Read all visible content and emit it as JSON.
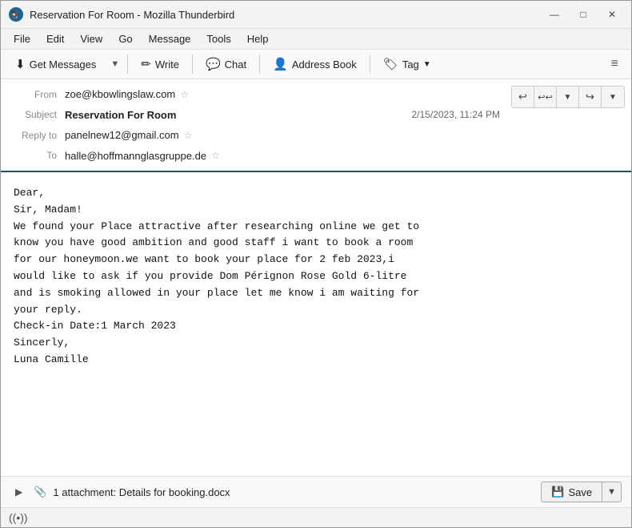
{
  "window": {
    "title": "Reservation For Room - Mozilla Thunderbird",
    "icon": "TB"
  },
  "window_controls": {
    "minimize": "—",
    "maximize": "□",
    "close": "✕"
  },
  "menu": {
    "items": [
      "File",
      "Edit",
      "View",
      "Go",
      "Message",
      "Tools",
      "Help"
    ]
  },
  "toolbar": {
    "get_messages_label": "Get Messages",
    "write_label": "Write",
    "chat_label": "Chat",
    "address_book_label": "Address Book",
    "tag_label": "Tag",
    "overflow": "≡"
  },
  "email": {
    "from_label": "From",
    "from_value": "zoe@kbowlingslaw.com",
    "subject_label": "Subject",
    "subject_value": "Reservation For Room",
    "date": "2/15/2023, 11:24 PM",
    "reply_to_label": "Reply to",
    "reply_to_value": "panelnew12@gmail.com",
    "to_label": "To",
    "to_value": "halle@hoffmannglasgruppe.de",
    "body": "Dear,\nSir, Madam!\nWe found your Place attractive after researching online we get to\nknow you have good ambition and good staff i want to book a room\nfor our honeymoon.we want to book your place for 2 feb 2023,i\nwould like to ask if you provide Dom Pérignon Rose Gold 6-litre\nand is smoking allowed in your place let me know i am waiting for\nyour reply.\nCheck-in Date:1 March 2023\nSincerly,\nLuna Camille"
  },
  "attachment": {
    "count": "1",
    "label": "1 attachment: Details for booking.docx",
    "save_label": "Save"
  },
  "status_bar": {
    "icon": "((•))",
    "text": ""
  },
  "reply_buttons": {
    "reply": "↩",
    "reply_all": "↩↩",
    "dropdown": "⌄",
    "forward": "↪",
    "more": "⌄"
  }
}
